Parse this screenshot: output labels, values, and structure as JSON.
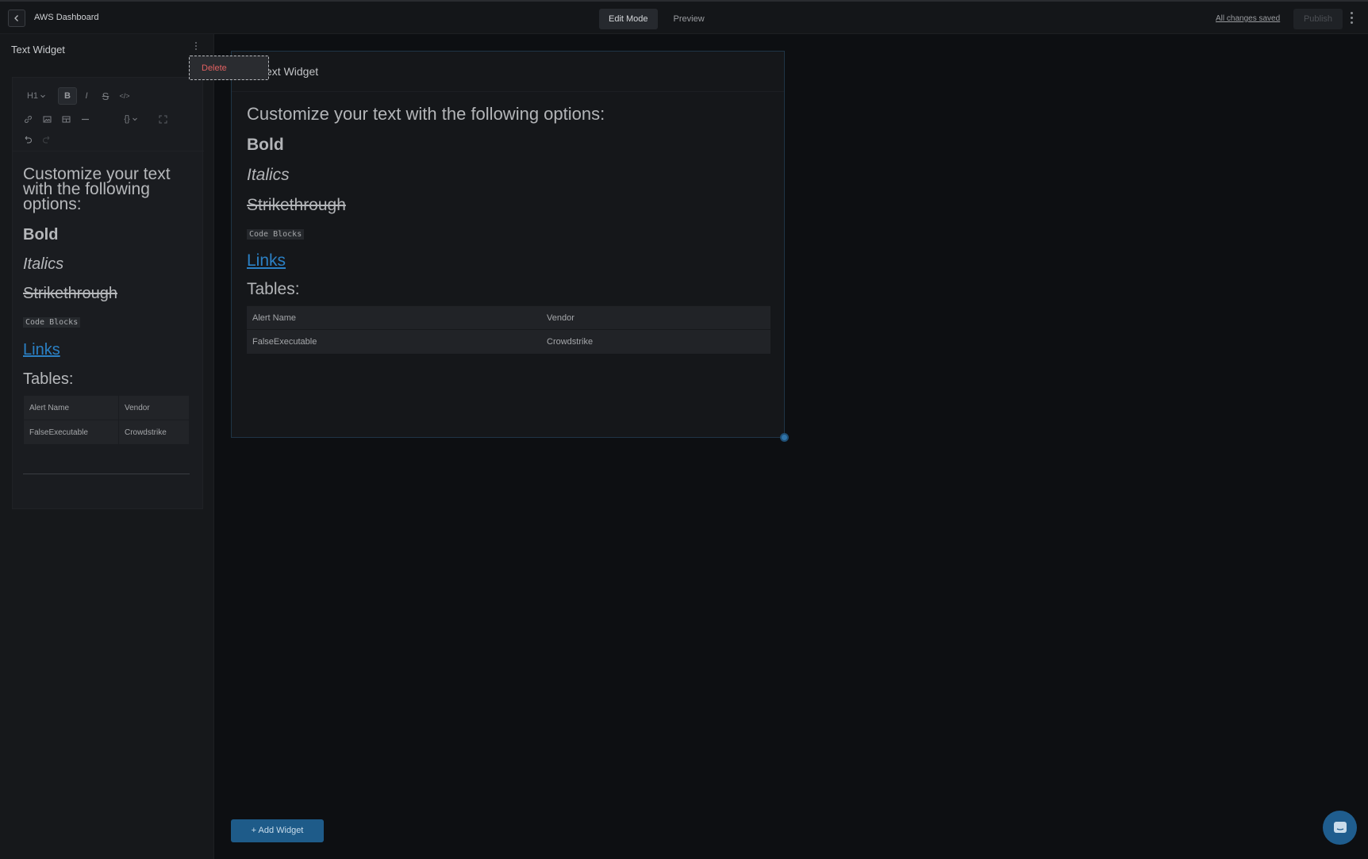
{
  "topbar": {
    "title": "AWS Dashboard",
    "tabs": [
      {
        "label": "Edit Mode",
        "active": true
      },
      {
        "label": "Preview",
        "active": false
      }
    ],
    "saved_status": "All changes saved",
    "publish_label": "Publish"
  },
  "sidebar": {
    "title": "Text Widget",
    "menu": {
      "delete_label": "Delete"
    },
    "toolbar": {
      "heading": "H1",
      "bold": "B",
      "italic": "I",
      "strike": "S",
      "code": "</>",
      "var": "{}"
    },
    "content": {
      "heading": "Customize your text with the following options:",
      "bold": "Bold",
      "italic": "Italics",
      "strike": "Strikethrough",
      "code": "Code Blocks",
      "link": "Links",
      "tables": "Tables:",
      "table": {
        "headers": [
          "Alert Name",
          "Vendor"
        ],
        "rows": [
          [
            "FalseExecutable",
            "Crowdstrike"
          ]
        ]
      }
    }
  },
  "widget": {
    "title": "Text Widget",
    "content": {
      "heading": "Customize your text with the following options:",
      "bold": "Bold",
      "italic": "Italics",
      "strike": "Strikethrough",
      "code": "Code Blocks",
      "link": "Links",
      "tables": "Tables:",
      "table": {
        "headers": [
          "Alert Name",
          "Vendor"
        ],
        "rows": [
          [
            "FalseExecutable",
            "Crowdstrike"
          ]
        ]
      }
    }
  },
  "add_widget_label": "+ Add Widget",
  "colors": {
    "accent": "#1e5b89",
    "link": "#2b80c4",
    "danger": "#e06161",
    "background": "#0d0f12"
  }
}
